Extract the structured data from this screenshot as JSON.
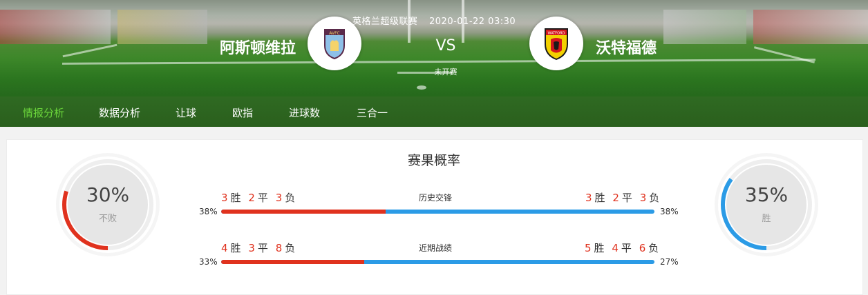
{
  "match": {
    "league": "英格兰超级联赛",
    "datetime": "2020-01-22 03:30",
    "vs": "VS",
    "status": "未开赛",
    "home": {
      "name": "阿斯顿维拉",
      "badge_text": "AVFC"
    },
    "away": {
      "name": "沃特福德",
      "badge_text": "WATFORD"
    }
  },
  "nav": {
    "tabs": [
      {
        "label": "情报分析",
        "active": true
      },
      {
        "label": "数据分析",
        "active": false
      },
      {
        "label": "让球",
        "active": false
      },
      {
        "label": "欧指",
        "active": false
      },
      {
        "label": "进球数",
        "active": false
      },
      {
        "label": "三合一",
        "active": false
      }
    ]
  },
  "probability": {
    "title": "赛果概率",
    "left": {
      "percent": "30%",
      "label": "不败",
      "value": 0.3,
      "color": "#e0321e"
    },
    "right": {
      "percent": "35%",
      "label": "胜",
      "value": 0.35,
      "color": "#2b9be6"
    }
  },
  "records": [
    {
      "label": "历史交锋",
      "home": {
        "w": "3",
        "d": "2",
        "l": "3",
        "pct": "38%"
      },
      "away": {
        "w": "3",
        "d": "2",
        "l": "3",
        "pct": "38%"
      },
      "split": 0.38
    },
    {
      "label": "近期战绩",
      "home": {
        "w": "4",
        "d": "3",
        "l": "8",
        "pct": "33%"
      },
      "away": {
        "w": "5",
        "d": "4",
        "l": "6",
        "pct": "27%"
      },
      "split": 0.33
    }
  ],
  "words": {
    "win": "胜",
    "draw": "平",
    "loss": "负"
  },
  "colors": {
    "accent_green": "#6bd63b",
    "home_red": "#e0321e",
    "away_blue": "#2b9be6"
  }
}
